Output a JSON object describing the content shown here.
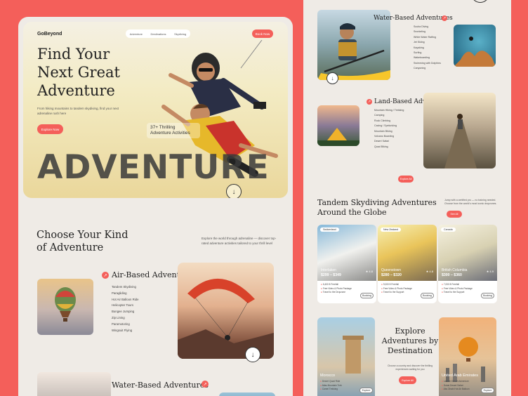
{
  "page1": {
    "logo": "GoBeyond",
    "nav": [
      "Adventure",
      "Destinations",
      "Skydiving"
    ],
    "book_now": "Book Now",
    "hero_title": "Find Your Next Great Adventure",
    "hero_subtitle": "From hiking mountains to tandem skydiving, find your next adrenaline rush here",
    "explore_now": "Explore Now",
    "stat": "37+ Thrilling Adventure Activities",
    "big_word": "ADVENTURE",
    "choose_title": "Choose Your Kind of Adventure",
    "choose_desc": "Explore the world through adrenaline — discover top-rated adventure activities tailored to your thrill level",
    "air": {
      "title": "Air-Based Adventures",
      "items": [
        "Tandem Skydiving",
        "Paragliding",
        "Hot Air Balloon Ride",
        "Helicopter Tours",
        "Bungee Jumping",
        "Zip Lining",
        "Paramotoring",
        "Wingsuit Flying"
      ]
    },
    "water_title": "Water-Based Adventures"
  },
  "page2": {
    "water": {
      "title": "Water-Based Adventures",
      "items": [
        "Scuba Diving",
        "Snorkeling",
        "White Water Rafting",
        "Jet Skiing",
        "Kayaking",
        "Surfing",
        "Wakeboarding",
        "Swimming with Dolphins",
        "Canyoning"
      ]
    },
    "land": {
      "title": "Land-Based Adventures",
      "items": [
        "Mountain Hiking / Trekking",
        "Camping",
        "Rock Climbing",
        "Caving / Spelunking",
        "Mountain Biking",
        "Volcano Boarding",
        "Desert Safari",
        "Quad Biking"
      ],
      "explore": "Explore All"
    },
    "tandem": {
      "title": "Tandem Skydiving Adventures Around the Globe",
      "desc": "Jump with a certified pro — no training needed. Choose from the world's most iconic dropzones.",
      "button": "See All"
    },
    "destinations": [
      {
        "pill": "Switzerland",
        "name": "Interlaken",
        "price": "$299 – $349",
        "rating": "★ 4.8",
        "features": [
          "6,400 ft Freefall",
          "Free Video & Photo Package",
          "Travel to the Dropzone"
        ],
        "book": "Booking"
      },
      {
        "pill": "New Zealand",
        "name": "Queenstown",
        "price": "$280 – $320",
        "rating": "★ 4.8",
        "features": [
          "9,000 ft Freefall",
          "Free Video & Photo Package",
          "Travel to the Support"
        ],
        "book": "Booking"
      },
      {
        "pill": "Canada",
        "name": "British Columbia",
        "price": "$300 – $360",
        "rating": "★ 4.9",
        "features": [
          "7,000 ft Freefall",
          "Free Video & Photo Package",
          "Travel to the Support"
        ],
        "book": "Booking"
      }
    ],
    "by_dest": {
      "title": "Explore Adventures by Destination",
      "desc": "Choose a country and discover the thrilling experiences waiting for you",
      "button": "Explore All"
    },
    "morocco": {
      "name": "Morocco",
      "items": [
        "Desert Quad Ride",
        "Atlas Mountain Trek",
        "Camel Trekking"
      ],
      "button": "Explore"
    },
    "uae": {
      "name": "United Arab Emirates",
      "items": [
        "Launch Desert Adventure",
        "Dubai Desert Safari",
        "Abu Dhabi Hot Air Balloon"
      ],
      "button": "Explore"
    }
  },
  "colors": {
    "accent": "#f45f5a",
    "background": "#efebe6"
  }
}
